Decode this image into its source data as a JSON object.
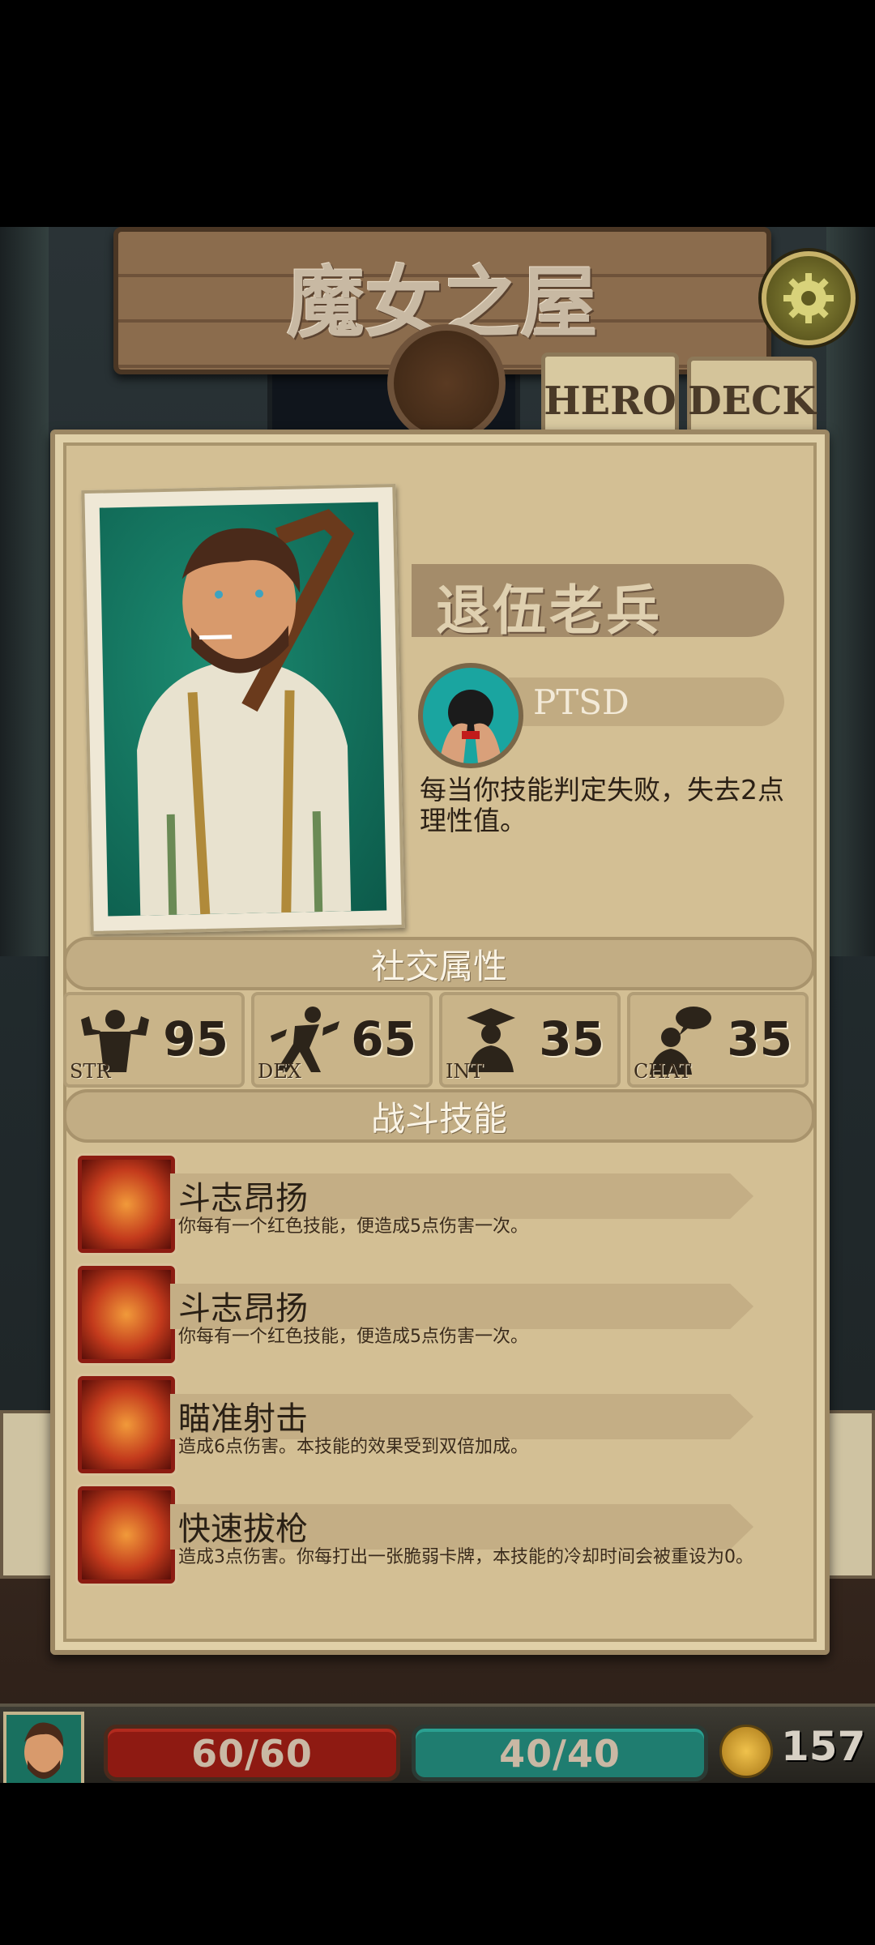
{
  "header": {
    "title": "魔女之屋"
  },
  "tabs": [
    {
      "label": "HERO",
      "active": true
    },
    {
      "label": "DECK",
      "active": false
    }
  ],
  "hero": {
    "class_name": "退伍老兵",
    "trait": {
      "name": "PTSD",
      "description": "每当你技能判定失败，失去2点理性值。"
    }
  },
  "sections": {
    "social": "社交属性",
    "combat": "战斗技能"
  },
  "stats": [
    {
      "label": "STR",
      "value": "95",
      "icon": "flexing-strongman-icon"
    },
    {
      "label": "DEX",
      "value": "65",
      "icon": "running-figure-icon"
    },
    {
      "label": "INT",
      "value": "35",
      "icon": "graduate-cap-icon"
    },
    {
      "label": "CHAT",
      "value": "35",
      "icon": "speech-bubble-person-icon"
    }
  ],
  "skills": [
    {
      "name": "斗志昂扬",
      "description": "你每有一个红色技能，便造成5点伤害一次。",
      "icon": "fist-punch-icon"
    },
    {
      "name": "斗志昂扬",
      "description": "你每有一个红色技能，便造成5点伤害一次。",
      "icon": "fist-punch-icon"
    },
    {
      "name": "瞄准射击",
      "description": "造成6点伤害。本技能的效果受到双倍加成。",
      "icon": "crosshair-shot-icon"
    },
    {
      "name": "快速拔枪",
      "description": "造成3点伤害。你每打出一张脆弱卡牌，本技能的冷却时间会被重设为0。",
      "icon": "quick-draw-pistol-icon"
    }
  ],
  "status": {
    "hp": "60/60",
    "sanity": "40/40",
    "coins": "157"
  },
  "colors": {
    "hp": "#8e1a12",
    "sanity": "#1f7d70",
    "skill_red": "#c33a1c",
    "panel": "#d3bf94"
  }
}
